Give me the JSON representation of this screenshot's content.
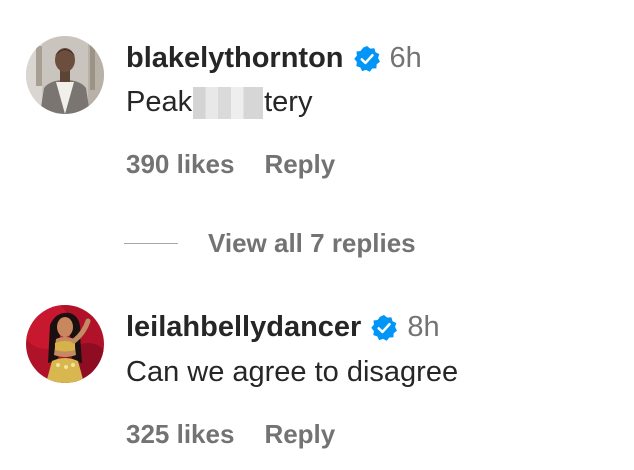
{
  "comments": [
    {
      "username": "blakelythornton",
      "verified": true,
      "time": "6h",
      "text_before": "Peak",
      "text_after": "tery",
      "likes": "390 likes",
      "reply_label": "Reply",
      "avatar_icon": "person-photo-avatar"
    },
    {
      "username": "leilahbellydancer",
      "verified": true,
      "time": "8h",
      "text": "Can we agree to disagree",
      "likes": "325 likes",
      "reply_label": "Reply",
      "avatar_icon": "dancer-photo-avatar"
    }
  ],
  "view_replies_label": "View all 7 replies",
  "colors": {
    "verified_badge": "#0095f6",
    "primary_text": "#262626",
    "secondary_text": "#737373"
  }
}
